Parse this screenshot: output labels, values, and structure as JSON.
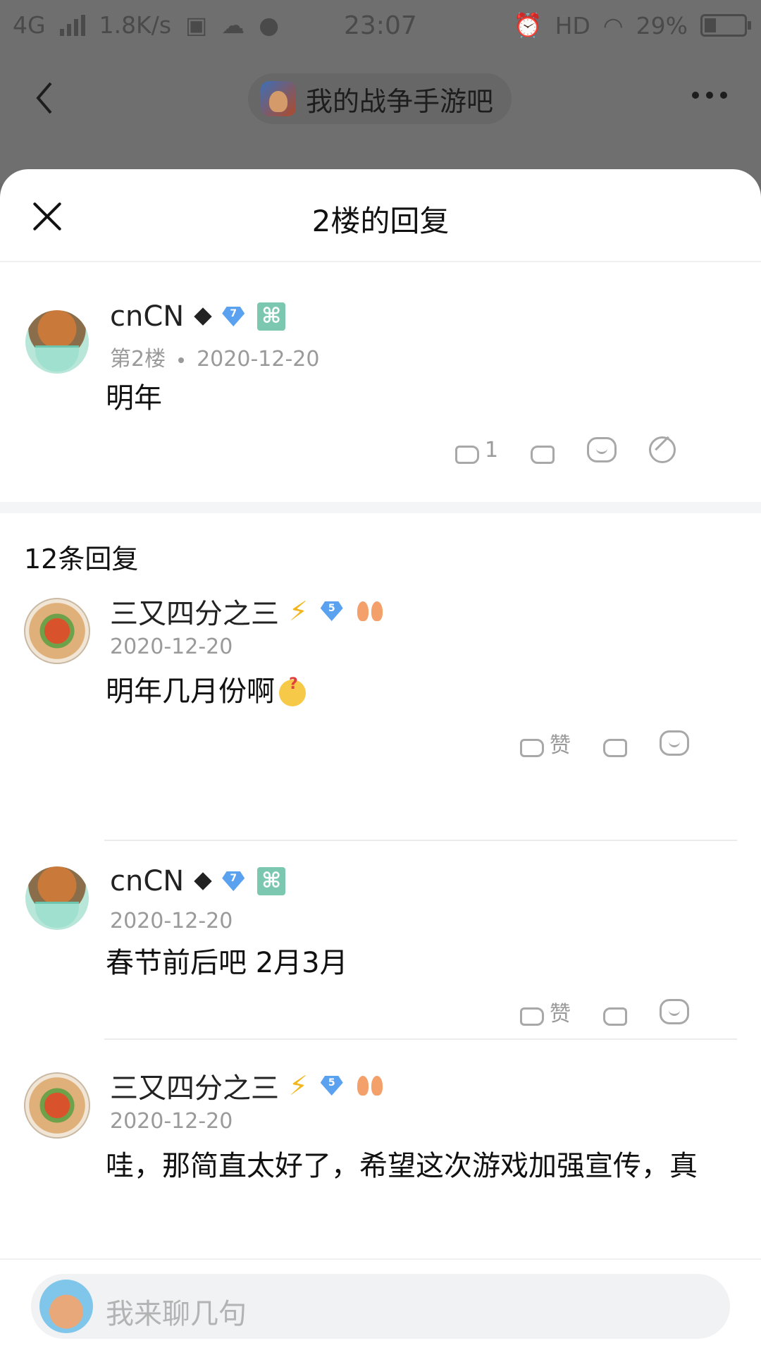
{
  "status_bar": {
    "network": "4G",
    "speed": "1.8K/s",
    "time": "23:07",
    "hd": "HD",
    "battery": "29%",
    "battery_level": 0.29
  },
  "nav": {
    "title": "我的战争手游吧",
    "icons": [
      "back-icon",
      "game-avatar",
      "more-icon"
    ]
  },
  "sheet": {
    "title": "2楼的回复"
  },
  "floor_post": {
    "username": "cnCN",
    "level": "7",
    "floor": "第2楼",
    "date": "2020-12-20",
    "content": "明年",
    "like_count": "1"
  },
  "replies_count": "12条回复",
  "replies": [
    {
      "username": "三又四分之三",
      "level": "5",
      "date": "2020-12-20",
      "content": "明年几月份啊",
      "like_label": "赞"
    },
    {
      "username": "cnCN",
      "level": "7",
      "date": "2020-12-20",
      "content": "春节前后吧 2月3月",
      "like_label": "赞"
    },
    {
      "username": "三又四分之三",
      "level": "5",
      "date": "2020-12-20",
      "content": "哇，那简直太好了，希望这次游戏加强宣传，真"
    }
  ],
  "input": {
    "placeholder": "我来聊几句"
  },
  "colors": {
    "accent_gem": "#5aa2f0",
    "badge_green": "#7cc7b0",
    "bolt": "#f2b51b"
  }
}
